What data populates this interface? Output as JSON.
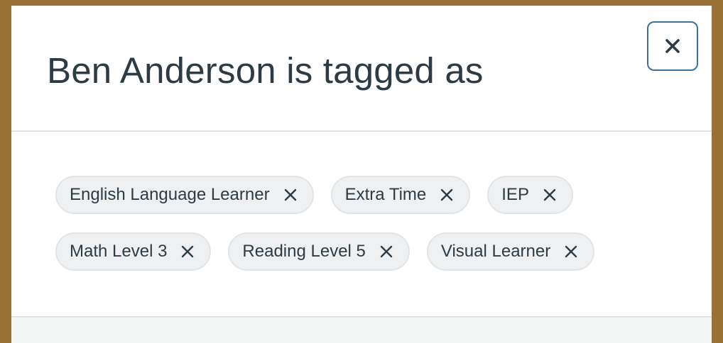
{
  "modal": {
    "title": "Ben Anderson is tagged as",
    "close_icon": "close-icon",
    "tags": [
      {
        "label": "English Language Learner",
        "remove_icon": "close-icon"
      },
      {
        "label": "Extra Time",
        "remove_icon": "close-icon"
      },
      {
        "label": "IEP",
        "remove_icon": "close-icon"
      },
      {
        "label": "Math Level 3",
        "remove_icon": "close-icon"
      },
      {
        "label": "Reading Level 5",
        "remove_icon": "close-icon"
      },
      {
        "label": "Visual Learner",
        "remove_icon": "close-icon"
      }
    ]
  },
  "colors": {
    "frame": "#9a7237",
    "title_text": "#2d3b45",
    "close_border": "#3a6f9e",
    "tag_background": "#eef0f1",
    "footer_background": "#f4f5f5"
  }
}
